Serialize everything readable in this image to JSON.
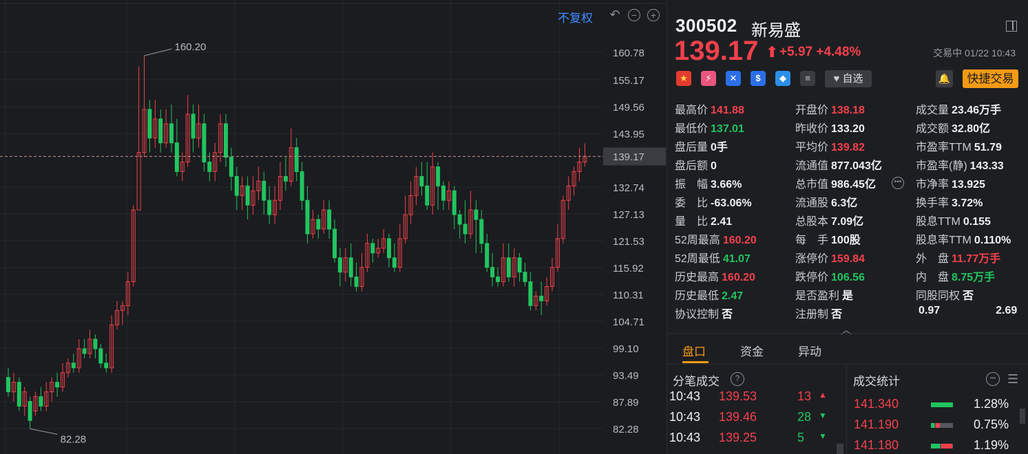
{
  "chart": {
    "adjust_label": "不复权",
    "y_ticks": [
      "160.78",
      "155.17",
      "149.56",
      "143.95",
      "139.17",
      "132.74",
      "127.13",
      "121.53",
      "115.92",
      "110.31",
      "104.71",
      "99.10",
      "93.49",
      "87.89",
      "82.28"
    ],
    "current_price_label": "139.17",
    "high_marker": "160.20",
    "low_marker": "82.28",
    "colors": {
      "up": "#f2414b",
      "down": "#21c45f",
      "bg": "#1b1c1f"
    }
  },
  "header": {
    "code": "300502",
    "name": "新易盛",
    "price": "139.17",
    "arrow": "⬆",
    "change": "+5.97",
    "change_pct": "+4.48%",
    "status": "交易中 01/22 10:43",
    "watch_label": "自选",
    "quick_trade_label": "快捷交易"
  },
  "quote": {
    "col1": [
      {
        "label": "最高价",
        "value": "141.88",
        "color": "red"
      },
      {
        "label": "最低价",
        "value": "137.01",
        "color": "green"
      },
      {
        "label": "盘后量",
        "value": "0手",
        "color": "white"
      },
      {
        "label": "盘后额",
        "value": "0",
        "color": "white"
      },
      {
        "label": "振　幅",
        "value": "3.66%",
        "color": "white"
      },
      {
        "label": "委　比",
        "value": "-63.06%",
        "color": "white"
      },
      {
        "label": "量　比",
        "value": "2.41",
        "color": "white"
      },
      {
        "label": "52周最高",
        "value": "160.20",
        "color": "red"
      },
      {
        "label": "52周最低",
        "value": "41.07",
        "color": "green"
      },
      {
        "label": "历史最高",
        "value": "160.20",
        "color": "red"
      },
      {
        "label": "历史最低",
        "value": "2.47",
        "color": "green"
      },
      {
        "label": "协议控制",
        "value": "否",
        "color": "white"
      }
    ],
    "col2": [
      {
        "label": "开盘价",
        "value": "138.18",
        "color": "red"
      },
      {
        "label": "昨收价",
        "value": "133.20",
        "color": "white"
      },
      {
        "label": "平均价",
        "value": "139.82",
        "color": "red"
      },
      {
        "label": "流通值",
        "value": "877.043亿",
        "color": "white"
      },
      {
        "label": "总市值",
        "value": "986.45亿",
        "color": "white"
      },
      {
        "label": "流通股",
        "value": "6.3亿",
        "color": "white"
      },
      {
        "label": "总股本",
        "value": "7.09亿",
        "color": "white"
      },
      {
        "label": "每　手",
        "value": "100股",
        "color": "white"
      },
      {
        "label": "涨停价",
        "value": "159.84",
        "color": "red"
      },
      {
        "label": "跌停价",
        "value": "106.56",
        "color": "green"
      },
      {
        "label": "是否盈利",
        "value": "是",
        "color": "white"
      },
      {
        "label": "注册制",
        "value": "否",
        "color": "white"
      }
    ],
    "col3": [
      {
        "label": "成交量",
        "value": "23.46万手",
        "color": "white"
      },
      {
        "label": "成交额",
        "value": "32.80亿",
        "color": "white"
      },
      {
        "label": "市盈率TTM",
        "value": "51.79",
        "color": "white"
      },
      {
        "label": "市盈率(静)",
        "value": "143.33",
        "color": "white"
      },
      {
        "label": "市净率",
        "value": "13.925",
        "color": "white"
      },
      {
        "label": "换手率",
        "value": "3.72%",
        "color": "white"
      },
      {
        "label": "股息TTM",
        "value": "0.155",
        "color": "white"
      },
      {
        "label": "股息率TTM",
        "value": "0.110%",
        "color": "white"
      },
      {
        "label": "外　盘",
        "value": "11.77万手",
        "color": "red"
      },
      {
        "label": "内　盘",
        "value": "8.75万手",
        "color": "green"
      },
      {
        "label": "同股同权",
        "value": "否",
        "color": "white"
      },
      {
        "label": "0.97",
        "value": "2.69",
        "color": "white"
      }
    ]
  },
  "tabs": [
    "盘口",
    "资金",
    "异动"
  ],
  "ticks_section": {
    "title": "分笔成交",
    "rows": [
      {
        "time": "10:43",
        "price": "139.53",
        "vol": "13",
        "dir": "up"
      },
      {
        "time": "10:43",
        "price": "139.46",
        "vol": "28",
        "dir": "down"
      },
      {
        "time": "10:43",
        "price": "139.25",
        "vol": "5",
        "dir": "down"
      }
    ]
  },
  "stats_section": {
    "title": "成交统计",
    "rows": [
      {
        "price": "141.340",
        "pct": "1.28%",
        "buy": 1.0,
        "sell": 0.0
      },
      {
        "price": "141.190",
        "pct": "0.75%",
        "buy": 0.15,
        "sell": 0.2
      },
      {
        "price": "141.180",
        "pct": "1.19%",
        "buy": 0.4,
        "sell": 0.5
      }
    ]
  }
}
